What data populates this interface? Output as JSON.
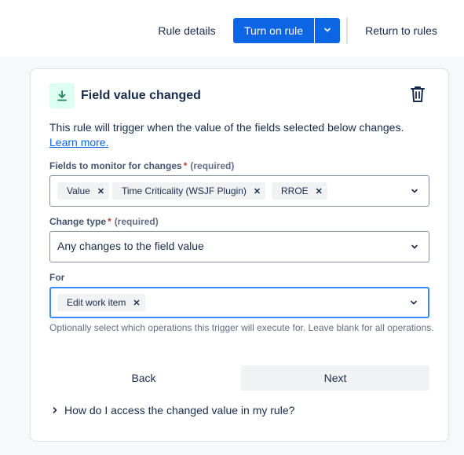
{
  "header": {
    "rule_details_label": "Rule details",
    "turn_on_label": "Turn on rule",
    "return_label": "Return to rules"
  },
  "card": {
    "title": "Field value changed",
    "description": "This rule will trigger when the value of the fields selected below changes.",
    "learn_more": "Learn more.",
    "fields_monitor": {
      "label": "Fields to monitor for changes",
      "required_star": "*",
      "required_text": "(required)",
      "tags": [
        "Value",
        "Time Criticality (WSJF Plugin)",
        "RROE"
      ]
    },
    "change_type": {
      "label": "Change type",
      "required_star": "*",
      "required_text": "(required)",
      "value": "Any changes to the field value"
    },
    "for_field": {
      "label": "For",
      "tags": [
        "Edit work item"
      ]
    },
    "helper_text": "Optionally select which operations this trigger will execute for. Leave blank for all operations.",
    "back_label": "Back",
    "next_label": "Next",
    "faq_label": "How do I access the changed value in my rule?"
  },
  "colors": {
    "primary": "#0c66e4",
    "required": "#c9372c",
    "icon_bg": "#dcfff1",
    "icon_fg": "#1f845a",
    "focus": "#388bff"
  },
  "icons": {
    "trigger": "download-arrow-icon",
    "delete": "trash-icon",
    "dropdown": "chevron-down-icon",
    "expand": "chevron-right-icon",
    "tag_remove": "close-icon"
  }
}
